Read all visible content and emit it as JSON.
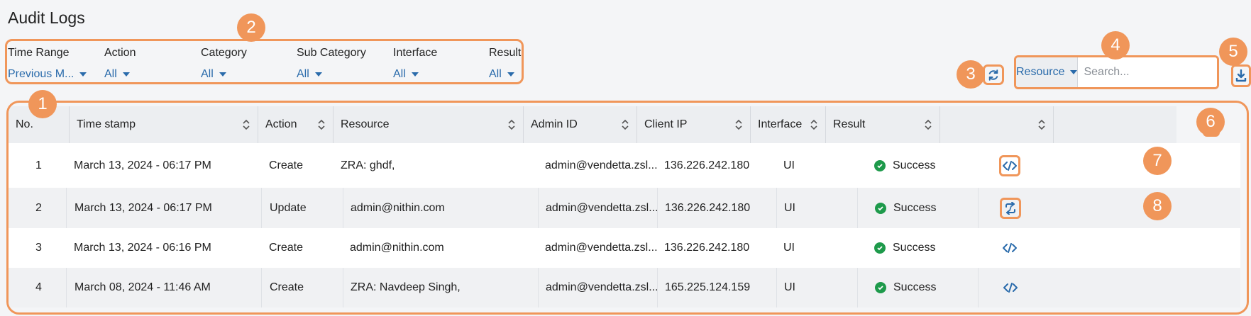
{
  "page": {
    "title": "Audit Logs"
  },
  "filters": [
    {
      "label": "Time Range",
      "value": "Previous M..."
    },
    {
      "label": "Action",
      "value": "All"
    },
    {
      "label": "Category",
      "value": "All"
    },
    {
      "label": "Sub Category",
      "value": "All"
    },
    {
      "label": "Interface",
      "value": "All"
    },
    {
      "label": "Result",
      "value": "All"
    }
  ],
  "search": {
    "scope": "Resource",
    "placeholder": "Search...",
    "value": ""
  },
  "table": {
    "headers": [
      "No.",
      "Time stamp",
      "Action",
      "Resource",
      "Admin ID",
      "Client IP",
      "Interface",
      "Result",
      ""
    ],
    "rows": [
      {
        "no": "1",
        "timestamp": "March 13, 2024 - 06:17 PM",
        "action": "Create",
        "resource": "ZRA: ghdf,",
        "admin_id": "admin@vendetta.zsl...",
        "client_ip": "136.226.242.180",
        "interface": "UI",
        "result": "Success",
        "row_icon": "code-icon"
      },
      {
        "no": "2",
        "timestamp": "March 13, 2024 - 06:17 PM",
        "action": "Update",
        "resource": "admin@nithin.com",
        "admin_id": "admin@vendetta.zsl...",
        "client_ip": "136.226.242.180",
        "interface": "UI",
        "result": "Success",
        "row_icon": "compare-icon"
      },
      {
        "no": "3",
        "timestamp": "March 13, 2024 - 06:16 PM",
        "action": "Create",
        "resource": "admin@nithin.com",
        "admin_id": "admin@vendetta.zsl...",
        "client_ip": "136.226.242.180",
        "interface": "UI",
        "result": "Success",
        "row_icon": "code-icon"
      },
      {
        "no": "4",
        "timestamp": "March 08, 2024 - 11:46 AM",
        "action": "Create",
        "resource": "ZRA: Navdeep Singh,",
        "admin_id": "admin@vendetta.zsl...",
        "client_ip": "165.225.124.159",
        "interface": "UI",
        "result": "Success",
        "row_icon": "code-icon"
      }
    ]
  },
  "callouts": [
    "1",
    "2",
    "3",
    "4",
    "5",
    "6",
    "7",
    "8"
  ],
  "colors": {
    "accent": "#2a6bab",
    "callout": "#f0965a",
    "success": "#1e9a4b"
  }
}
